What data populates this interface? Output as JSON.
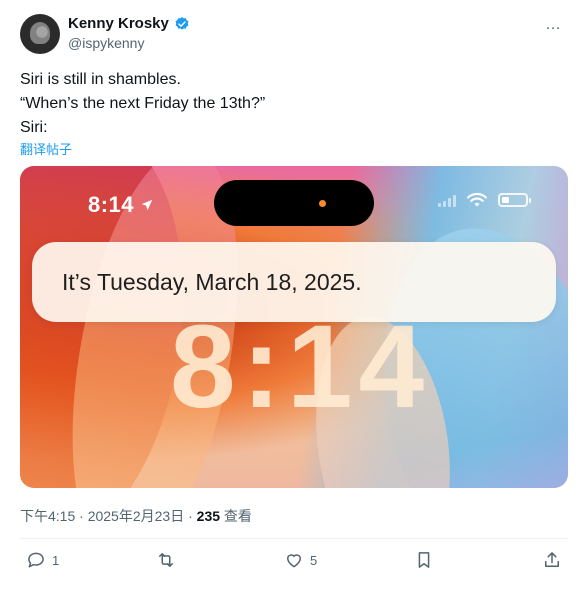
{
  "author": {
    "name": "Kenny Krosky",
    "handle": "@ispykenny",
    "verified": true,
    "more_menu_label": "…"
  },
  "tweet": {
    "lines": [
      "Siri is still in shambles.",
      "“When’s the next Friday the 13th?”",
      "Siri:"
    ],
    "translate_label": "翻译帖子"
  },
  "media": {
    "status_time": "8:14",
    "lockscreen_clock": "8:14",
    "siri_response": "It’s Tuesday, March 18, 2025.",
    "island_dot_color": "#ff8a2a"
  },
  "meta": {
    "time": "下午4:15",
    "date": "2025年2月23日",
    "views_count": "235",
    "views_label": "查看",
    "separator": "·"
  },
  "actions": {
    "reply_count": "1",
    "retweet_count": "",
    "like_count": "5"
  },
  "colors": {
    "accent": "#1d9bf0",
    "secondary_text": "#536471"
  }
}
